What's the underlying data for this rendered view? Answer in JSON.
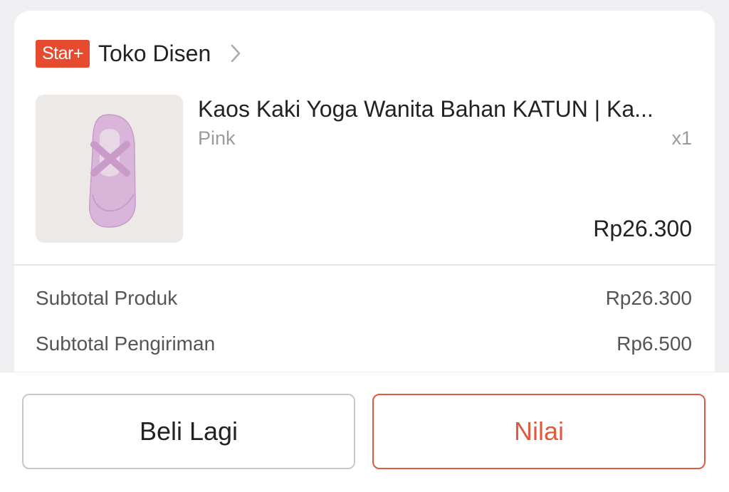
{
  "shop": {
    "badge": "Star+",
    "name": "Toko Disen"
  },
  "product": {
    "title": "Kaos Kaki Yoga Wanita Bahan KATUN | Ka...",
    "variant": "Pink",
    "quantity": "x1",
    "price": "Rp26.300"
  },
  "summary": {
    "rows": [
      {
        "label": "Subtotal Produk",
        "value": "Rp26.300"
      },
      {
        "label": "Subtotal Pengiriman",
        "value": "Rp6.500"
      }
    ]
  },
  "actions": {
    "buy_again_label": "Beli Lagi",
    "rate_label": "Nilai"
  },
  "colors": {
    "accent": "#e64a2f",
    "background": "#efeff1"
  },
  "icons": {
    "shop_link": "chevron-right-icon"
  }
}
